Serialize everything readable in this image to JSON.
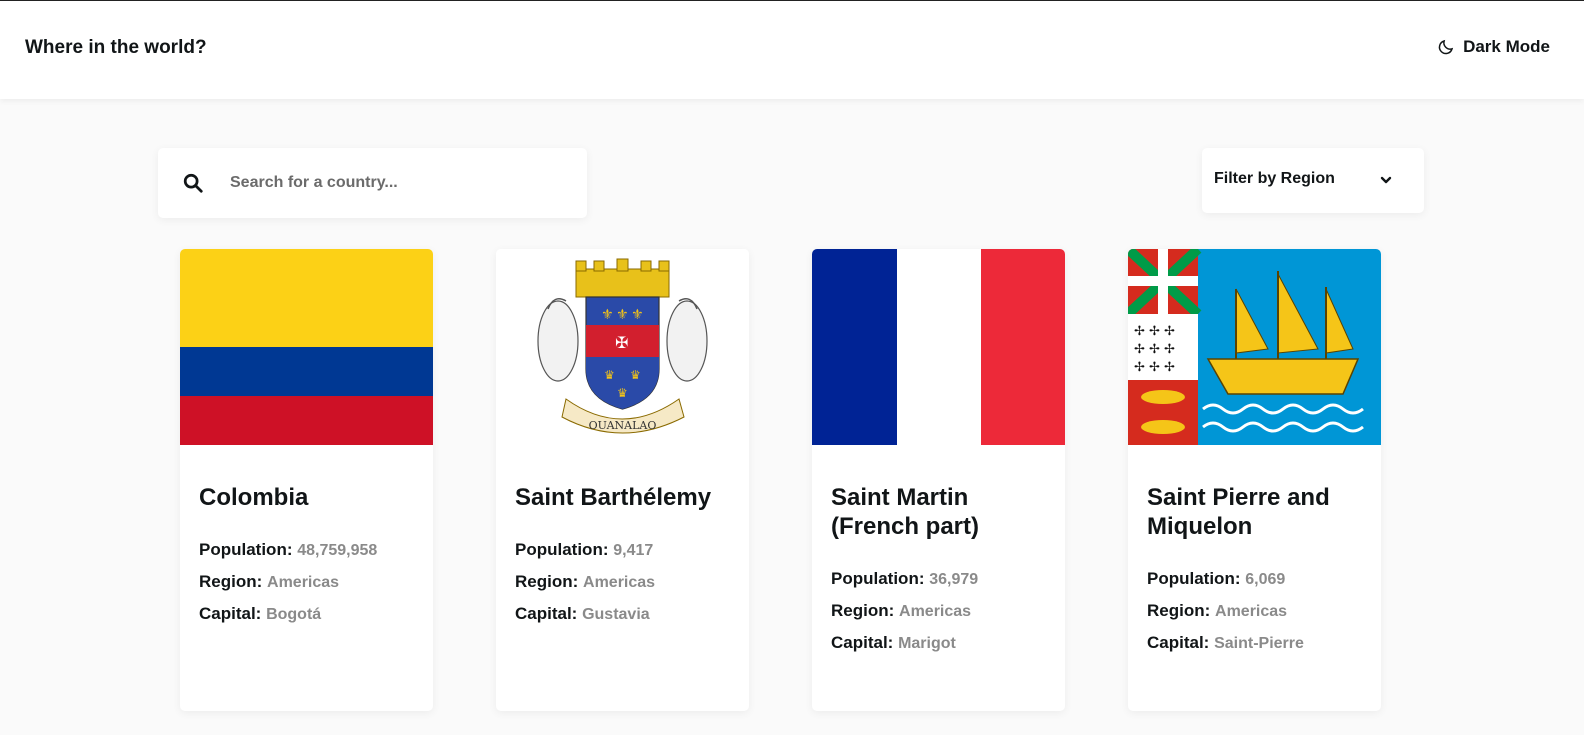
{
  "header": {
    "title": "Where in the world?",
    "dark_mode_label": "Dark Mode"
  },
  "search": {
    "placeholder": "Search for a country..."
  },
  "filter": {
    "label": "Filter by Region"
  },
  "labels": {
    "population": "Population:",
    "region": "Region:",
    "capital": "Capital:"
  },
  "countries": [
    {
      "name": "Colombia",
      "population": "48,759,958",
      "region": "Americas",
      "capital": "Bogotá"
    },
    {
      "name": "Saint Barthélemy",
      "population": "9,417",
      "region": "Americas",
      "capital": "Gustavia",
      "emblem_text": "OUANALAO"
    },
    {
      "name": "Saint Martin (French part)",
      "population": "36,979",
      "region": "Americas",
      "capital": "Marigot"
    },
    {
      "name": "Saint Pierre and Miquelon",
      "population": "6,069",
      "region": "Americas",
      "capital": "Saint-Pierre"
    }
  ],
  "colors": {
    "background": "#fafafa",
    "card": "#ffffff",
    "text": "#111517",
    "muted": "#8a8a8a"
  }
}
